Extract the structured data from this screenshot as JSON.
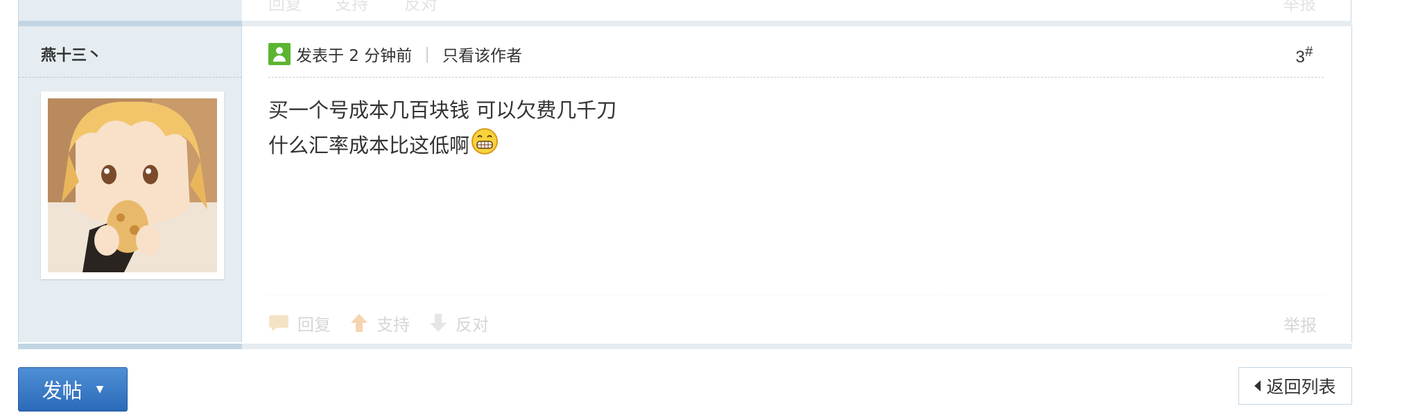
{
  "previous_post": {
    "actions": {
      "reply": "回复",
      "support": "支持",
      "oppose": "反对"
    },
    "report": "举报"
  },
  "post": {
    "author": "燕十三丶",
    "posted_at": "发表于 2 分钟前",
    "only_author": "只看该作者",
    "floor_number": "3",
    "floor_mark": "#",
    "content_lines": [
      "买一个号成本几百块钱 可以欠费几千刀",
      "什么汇率成本比这低啊"
    ],
    "smiley_icon": "grin-smiley-icon",
    "actions": {
      "reply": "回复",
      "support": "支持",
      "oppose": "反对"
    },
    "report": "举报"
  },
  "footer": {
    "new_post_button": "发帖",
    "back_to_list": "返回列表"
  },
  "colors": {
    "sidebar_bg": "#e5edf2",
    "border": "#c2d5e3",
    "button_blue": "#2b6ab8",
    "user_icon_green": "#5cb531"
  }
}
